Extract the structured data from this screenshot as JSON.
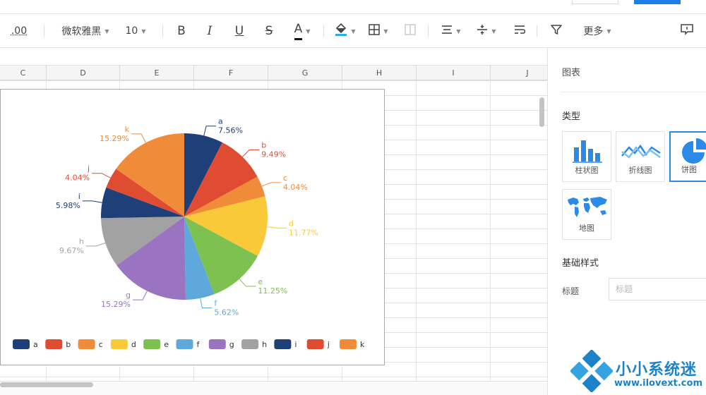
{
  "toolbar": {
    "decimal_label": ".00",
    "font_name": "微软雅黑",
    "font_size": "10",
    "bold": "B",
    "italic": "I",
    "underline": "U",
    "strike": "S",
    "font_color": "A",
    "more_label": "更多"
  },
  "columns": [
    "C",
    "D",
    "E",
    "F",
    "G",
    "H",
    "I",
    "J"
  ],
  "panel": {
    "title": "图表",
    "type_section": "类型",
    "types": [
      {
        "label": "柱状图",
        "icon": "bar-chart-icon"
      },
      {
        "label": "折线图",
        "icon": "line-chart-icon"
      },
      {
        "label": "饼图",
        "icon": "pie-chart-icon"
      },
      {
        "label": "地图",
        "icon": "map-icon"
      }
    ],
    "selected_type": "饼图",
    "style_section": "基础样式",
    "title_field_label": "标题",
    "title_field_placeholder": "标题"
  },
  "chart_data": {
    "type": "pie",
    "categories": [
      "a",
      "b",
      "c",
      "d",
      "e",
      "f",
      "g",
      "h",
      "i",
      "j",
      "k"
    ],
    "labels": [
      "7.56%",
      "9.49%",
      "4.04%",
      "11.77%",
      "11.25%",
      "5.62%",
      "15.29%",
      "9.67%",
      "5.98%",
      "4.04%",
      "15.29%"
    ],
    "values": [
      7.56,
      9.49,
      4.04,
      11.77,
      11.25,
      5.62,
      15.29,
      9.67,
      5.98,
      4.04,
      15.29
    ],
    "colors": [
      "#1f3f79",
      "#e04c32",
      "#ef8b39",
      "#f9c93a",
      "#7dc250",
      "#5fa8dc",
      "#9a74c0",
      "#a2a2a2",
      "#1f3f79",
      "#e04c32",
      "#ef8b39"
    ],
    "legend": "bottom",
    "start_angle_deg": 0,
    "direction": "clockwise"
  },
  "watermark": {
    "text": "小小系统迷",
    "url": "www.ilovext.com"
  },
  "colors": {
    "accent": "#2b8ae8"
  }
}
